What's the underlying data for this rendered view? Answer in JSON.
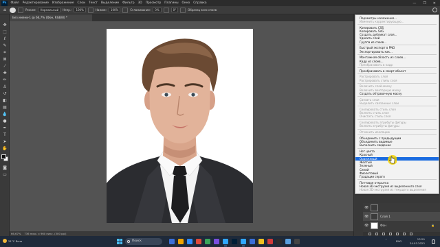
{
  "menubar": {
    "logo": "Ps",
    "items": [
      "Файл",
      "Редактирование",
      "Изображение",
      "Слои",
      "Текст",
      "Выделение",
      "Фильтр",
      "3D",
      "Просмотр",
      "Плагины",
      "Окно",
      "Справка"
    ],
    "window_controls": [
      "—",
      "❐",
      "✕"
    ]
  },
  "options_bar": {
    "size_label": "Кисть",
    "mode_label": "Режим:",
    "mode_value": "Нормальный",
    "opacity_label": "Непр.:",
    "opacity_value": "100%",
    "flow_label": "Нажим:",
    "flow_value": "100%",
    "smoothing_label": "Сглаживание:",
    "smoothing_value": "0%",
    "angle_value": "0°",
    "sample_label": "Образец всех слоев"
  },
  "document": {
    "tab_title": "Без имени-1 @ 66,7% (Фон, RGB/8) *",
    "zoom": "66,67%",
    "status": "736 пикс. х 960 пикс. (300 ppi)"
  },
  "context_menu": {
    "groups": [
      [
        {
          "label": "Параметры наложения...",
          "disabled": false
        },
        {
          "label": "Изменить корректирующую...",
          "disabled": true
        }
      ],
      [
        {
          "label": "Копировать CSS",
          "disabled": false
        },
        {
          "label": "Копировать SVG",
          "disabled": false
        },
        {
          "label": "Создать дубликат слоя...",
          "disabled": false
        },
        {
          "label": "Удалить слой",
          "disabled": false
        },
        {
          "label": "Группа из слоев...",
          "disabled": false
        }
      ],
      [
        {
          "label": "Быстрый экспорт в PNG",
          "disabled": false
        },
        {
          "label": "Экспортировать как...",
          "disabled": false
        }
      ],
      [
        {
          "label": "Монтажная область из слоев...",
          "disabled": false
        },
        {
          "label": "Кадр из слоев...",
          "disabled": false
        },
        {
          "label": "Преобразовать в кадр",
          "disabled": true
        }
      ],
      [
        {
          "label": "Преобразовать в смарт-объект",
          "disabled": false
        }
      ],
      [
        {
          "label": "Растрировать слой",
          "disabled": true
        },
        {
          "label": "Растрировать стиль слоя",
          "disabled": true
        }
      ],
      [
        {
          "label": "Включить слой-маску",
          "disabled": true
        },
        {
          "label": "Включить векторную маску",
          "disabled": true
        },
        {
          "label": "Создать обтравочную маску",
          "disabled": false
        }
      ],
      [
        {
          "label": "Связать слои",
          "disabled": true
        },
        {
          "label": "Выделить связанные слои",
          "disabled": true
        }
      ],
      [
        {
          "label": "Скопировать стиль слоя",
          "disabled": true
        },
        {
          "label": "Вклеить стиль слоя",
          "disabled": true
        },
        {
          "label": "Очистить стиль слоя",
          "disabled": true
        }
      ],
      [
        {
          "label": "Скопировать атрибуты фигуры",
          "disabled": true
        },
        {
          "label": "Вклеить атрибуты фигуры",
          "disabled": true
        }
      ],
      [
        {
          "label": "Отменить изоляцию",
          "disabled": true
        }
      ],
      [
        {
          "label": "Объединить с предыдущим",
          "disabled": false
        },
        {
          "label": "Объединить видимые",
          "disabled": false
        },
        {
          "label": "Выполнить сведение",
          "disabled": false
        }
      ],
      [
        {
          "label": "Нет цвета",
          "disabled": false
        },
        {
          "label": "Красный",
          "disabled": false
        },
        {
          "label": "Оранжевый",
          "disabled": false,
          "highlighted": true
        },
        {
          "label": "Желтый",
          "disabled": false
        },
        {
          "label": "Зеленый",
          "disabled": false
        },
        {
          "label": "Синий",
          "disabled": false
        },
        {
          "label": "Фиолетовый",
          "disabled": false
        },
        {
          "label": "Градации серого",
          "disabled": false
        }
      ],
      [
        {
          "label": "Почтовая открытка",
          "disabled": false
        },
        {
          "label": "Новая 3D-экструзия из выделенного слоя",
          "disabled": false
        },
        {
          "label": "Новая 3D-экструзия из текущего выделения",
          "disabled": true
        }
      ]
    ]
  },
  "layers": {
    "rows": [
      {
        "name": "",
        "selected": false,
        "dark": true
      },
      {
        "name": "Слой 1",
        "selected": true,
        "dark": true
      },
      {
        "name": "Фон",
        "selected": false,
        "dark": false
      }
    ],
    "lock_glyph": "🔒"
  },
  "taskbar": {
    "weather": "21°C Ясно",
    "search_placeholder": "Поиск",
    "tray_lang": "ENG",
    "time": "13:29",
    "date": "24.03.2023",
    "app_colors": [
      "#3b6fd8",
      "#f0a400",
      "#2d8cff",
      "#e04a3a",
      "#3aa65b",
      "#7b4fe0",
      "#31a8ff",
      "#001e36",
      "#31a8ff",
      "#3b6fd8",
      "#f0c020",
      "#d23a3a",
      "#2c2c2c",
      "#5aa0e0",
      "#444"
    ]
  }
}
